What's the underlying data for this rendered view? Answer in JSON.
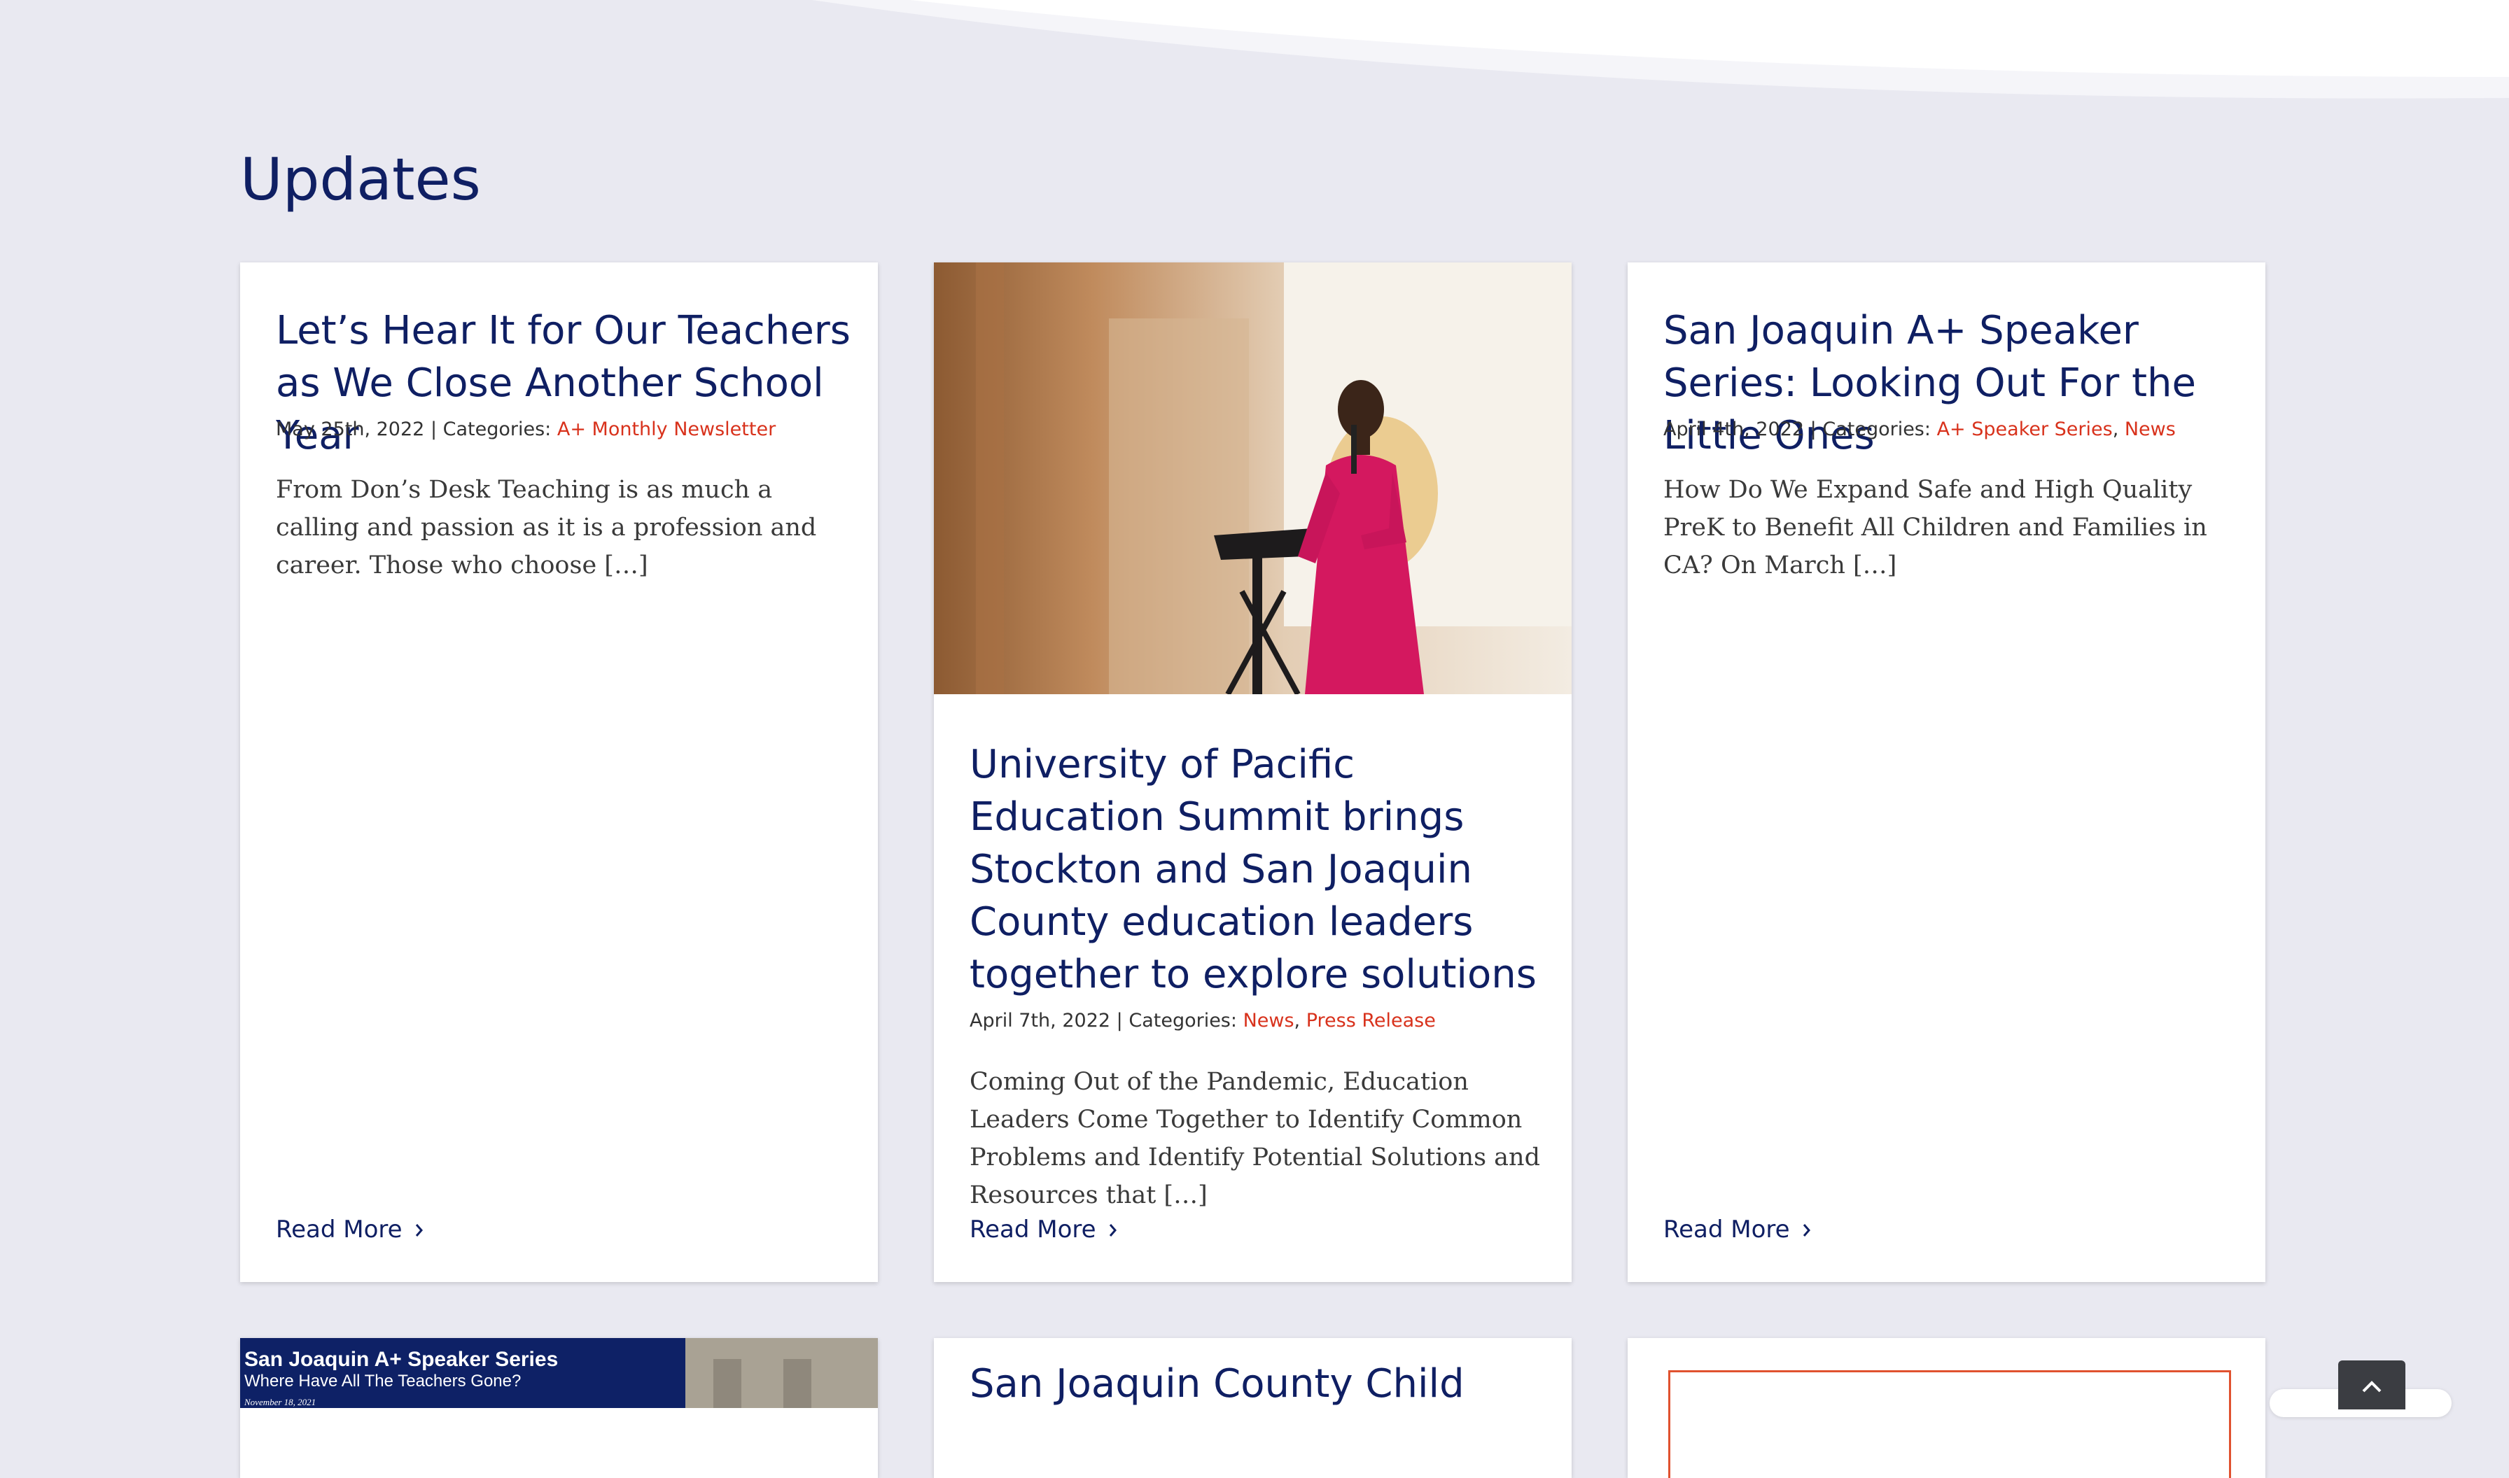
{
  "section": {
    "title": "Updates"
  },
  "posts": [
    {
      "title": "Let’s Hear It for Our Teachers as We Close Another School Year",
      "date": "May 25th, 2022",
      "categories_label": "Categories:",
      "categories": [
        "A+ Monthly Newsletter"
      ],
      "excerpt": "From Don’s Desk Teaching is as much a calling and passion as it is a profession and career. Those who choose […]",
      "read_more": "Read More"
    },
    {
      "title": "University of Pacific Education Summit brings Stockton and San Joaquin County education leaders together to explore solutions",
      "date": "April 7th, 2022",
      "categories_label": "Categories:",
      "categories": [
        "News",
        "Press Release"
      ],
      "excerpt": "Coming Out of the Pandemic, Education Leaders Come Together to Identify Common Problems and Identify Potential Solutions and Resources that […]",
      "read_more": "Read More"
    },
    {
      "title": "San Joaquin A+ Speaker Series: Looking Out For the Little Ones",
      "date": "April 4th, 2022",
      "categories_label": "Categories:",
      "categories": [
        "A+ Speaker Series",
        "News"
      ],
      "excerpt": "How Do We Expand Safe and High Quality PreK to Benefit All Children and Families in CA? On March […]",
      "read_more": "Read More"
    }
  ],
  "next_row": {
    "thumb_title": "San Joaquin A+ Speaker Series",
    "thumb_subtitle": "Where Have All The Teachers Gone?",
    "thumb_date": "November 18, 2021",
    "partial_title": "San Joaquin County Child"
  },
  "colors": {
    "background": "#e9e9f1",
    "heading": "#0f1f63",
    "category_link": "#d8321c"
  },
  "icons": {
    "read_more_chevron": "chevron-right-icon",
    "scroll_top": "chevron-up-icon"
  }
}
